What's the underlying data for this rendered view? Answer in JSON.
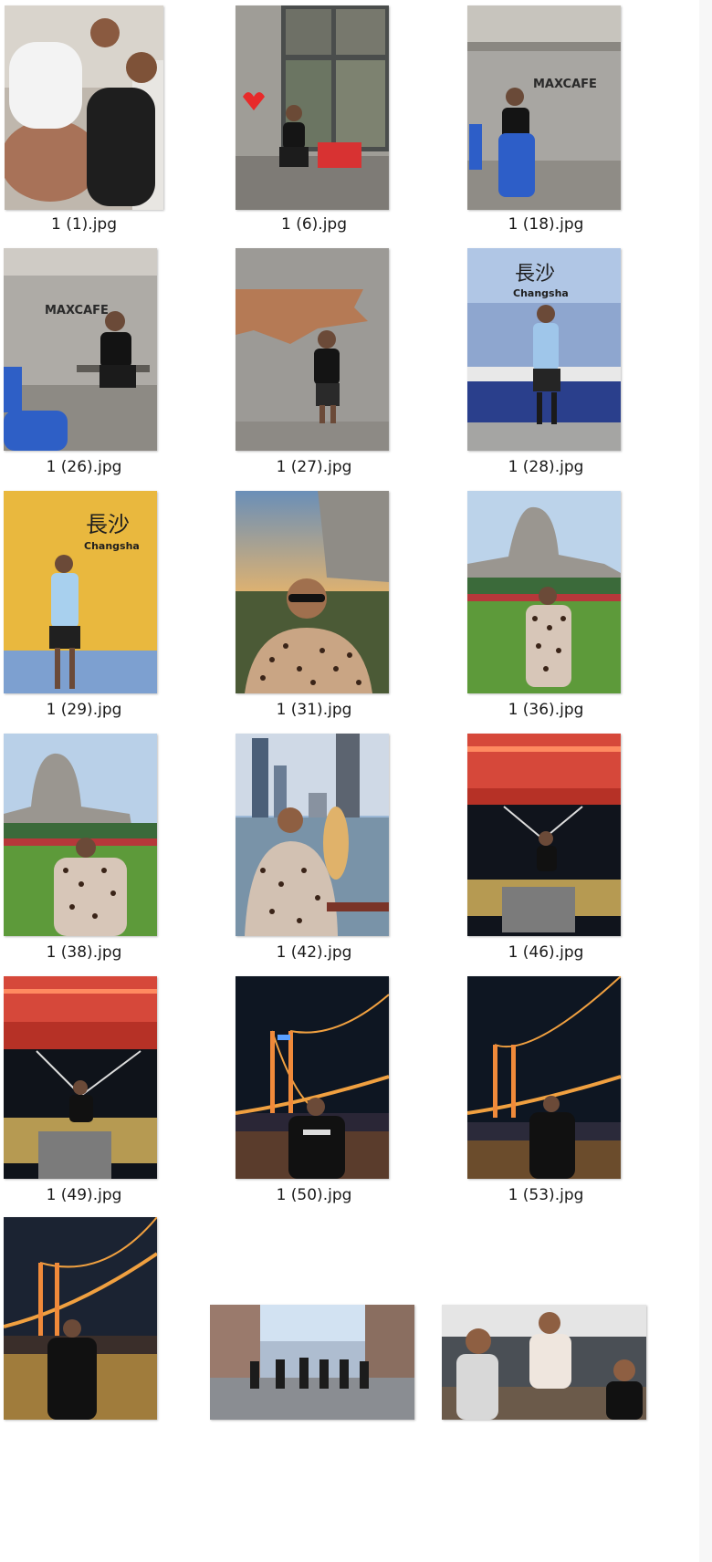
{
  "files": [
    {
      "name": "1 (1).jpg",
      "photo": "couple-indoor"
    },
    {
      "name": "1 (6).jpg",
      "photo": "cafe-window-heart"
    },
    {
      "name": "1 (18).jpg",
      "photo": "maxcafe-blue-chair"
    },
    {
      "name": "1 (26).jpg",
      "photo": "maxcafe-seated"
    },
    {
      "name": "1 (27).jpg",
      "photo": "brick-wall-man"
    },
    {
      "name": "1 (28).jpg",
      "photo": "changsha-blue-tile"
    },
    {
      "name": "1 (29).jpg",
      "photo": "changsha-yellow-tile"
    },
    {
      "name": "1 (31).jpg",
      "photo": "sunset-statue-selfie"
    },
    {
      "name": "1 (36).jpg",
      "photo": "statue-lawn"
    },
    {
      "name": "1 (38).jpg",
      "photo": "statue-lawn-close"
    },
    {
      "name": "1 (42).jpg",
      "photo": "skyline-river"
    },
    {
      "name": "1 (46).jpg",
      "photo": "night-red-canopy"
    },
    {
      "name": "1 (49).jpg",
      "photo": "night-red-canopy-2"
    },
    {
      "name": "1 (50).jpg",
      "photo": "bridge-night"
    },
    {
      "name": "1 (53).jpg",
      "photo": "bridge-night-2"
    },
    {
      "name": "",
      "photo": "bridge-night-3"
    },
    {
      "name": "",
      "photo": "street-group"
    },
    {
      "name": "",
      "photo": "cafe-interior-group"
    }
  ],
  "signs": {
    "maxcafe": "MAXCAFE",
    "changsha_cn": "長沙",
    "changsha_en": "Changsha"
  },
  "colors": {
    "background": "#ffffff",
    "filename_text": "#1a1a1a"
  }
}
